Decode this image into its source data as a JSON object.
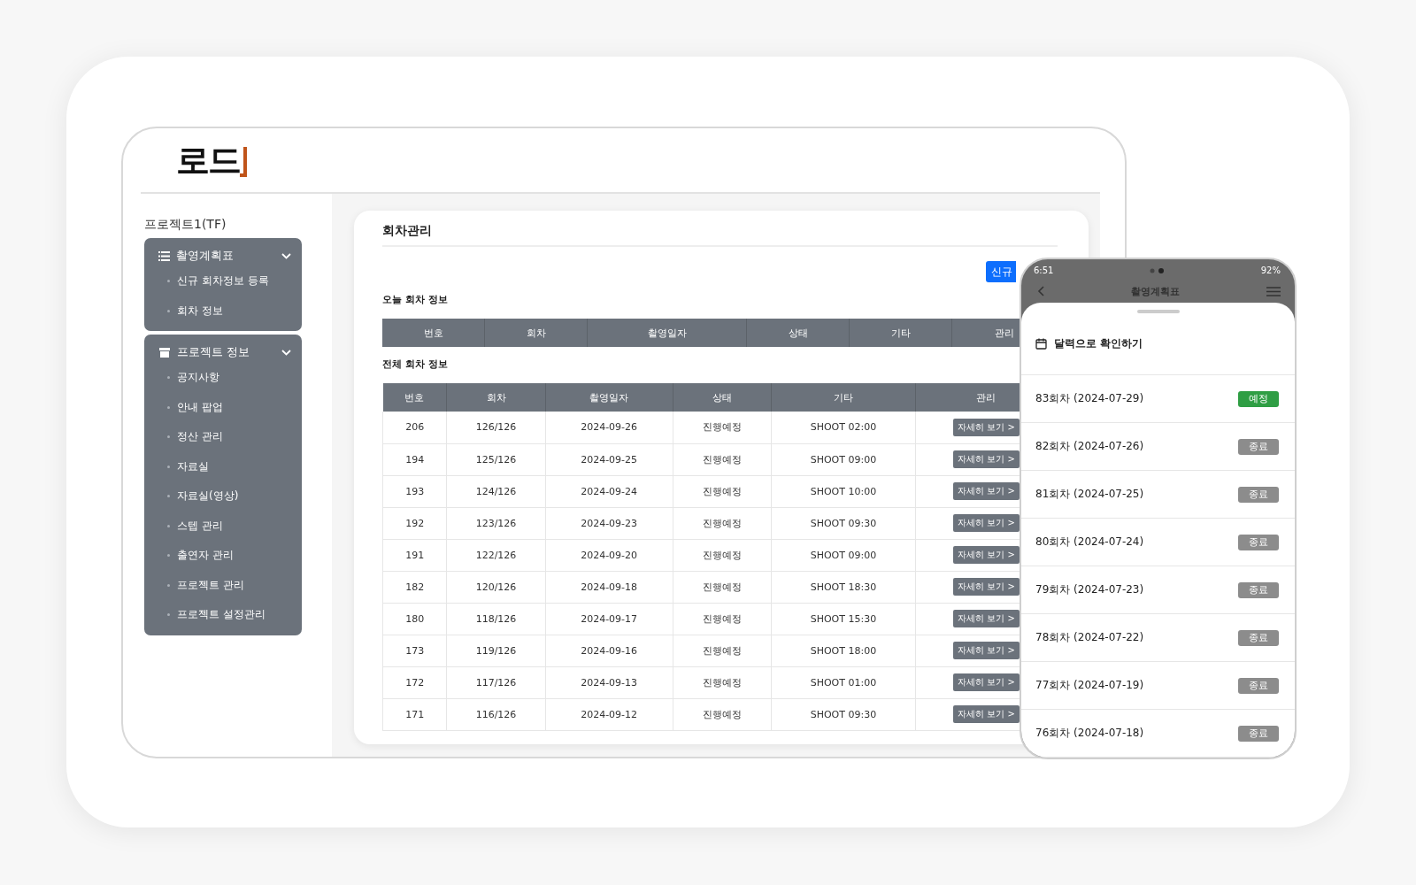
{
  "logo": {
    "text": "로드"
  },
  "sidebar": {
    "project": "프로젝트1(TF)",
    "groups": [
      {
        "title": "촬영계획표",
        "kind": "list",
        "expanded": true,
        "items": [
          "신규 회차정보 등록",
          "회차 정보"
        ]
      },
      {
        "title": "프로젝트 정보",
        "kind": "box",
        "expanded": true,
        "items": [
          "공지사항",
          "안내 팝업",
          "정산 관리",
          "자료실",
          "자료실(영상)",
          "스텝 관리",
          "출연자 관리",
          "프로젝트 관리",
          "프로젝트 설정관리"
        ]
      }
    ]
  },
  "main": {
    "title": "회차관리",
    "new_button": "신규",
    "today": {
      "heading": "오늘 회차 정보",
      "columns": [
        "번호",
        "회차",
        "촬영일자",
        "상태",
        "기타",
        "관리"
      ]
    },
    "all": {
      "heading": "전체 회차 정보",
      "columns": [
        "번호",
        "회차",
        "촬영일자",
        "상태",
        "기타",
        "관리"
      ],
      "rows": [
        {
          "no": "206",
          "round": "126/126",
          "date": "2024-09-26",
          "status": "진행예정",
          "note": "SHOOT 02:00",
          "action": "자세히 보기 >"
        },
        {
          "no": "194",
          "round": "125/126",
          "date": "2024-09-25",
          "status": "진행예정",
          "note": "SHOOT 09:00",
          "action": "자세히 보기 >"
        },
        {
          "no": "193",
          "round": "124/126",
          "date": "2024-09-24",
          "status": "진행예정",
          "note": "SHOOT 10:00",
          "action": "자세히 보기 >"
        },
        {
          "no": "192",
          "round": "123/126",
          "date": "2024-09-23",
          "status": "진행예정",
          "note": "SHOOT 09:30",
          "action": "자세히 보기 >"
        },
        {
          "no": "191",
          "round": "122/126",
          "date": "2024-09-20",
          "status": "진행예정",
          "note": "SHOOT 09:00",
          "action": "자세히 보기 >"
        },
        {
          "no": "182",
          "round": "120/126",
          "date": "2024-09-18",
          "status": "진행예정",
          "note": "SHOOT 18:30",
          "action": "자세히 보기 >"
        },
        {
          "no": "180",
          "round": "118/126",
          "date": "2024-09-17",
          "status": "진행예정",
          "note": "SHOOT 15:30",
          "action": "자세히 보기 >"
        },
        {
          "no": "173",
          "round": "119/126",
          "date": "2024-09-16",
          "status": "진행예정",
          "note": "SHOOT 18:00",
          "action": "자세히 보기 >"
        },
        {
          "no": "172",
          "round": "117/126",
          "date": "2024-09-13",
          "status": "진행예정",
          "note": "SHOOT 01:00",
          "action": "자세히 보기 >"
        },
        {
          "no": "171",
          "round": "116/126",
          "date": "2024-09-12",
          "status": "진행예정",
          "note": "SHOOT 09:30",
          "action": "자세히 보기 >"
        }
      ]
    }
  },
  "phone": {
    "time": "6:51",
    "battery": "92%",
    "title": "촬영계획표",
    "calendar_link": "달력으로 확인하기",
    "items": [
      {
        "label": "83회차 (2024-07-29)",
        "status": "예정",
        "kind": "upcoming"
      },
      {
        "label": "82회차 (2024-07-26)",
        "status": "종료",
        "kind": "done"
      },
      {
        "label": "81회차 (2024-07-25)",
        "status": "종료",
        "kind": "done"
      },
      {
        "label": "80회차 (2024-07-24)",
        "status": "종료",
        "kind": "done"
      },
      {
        "label": "79회차 (2024-07-23)",
        "status": "종료",
        "kind": "done"
      },
      {
        "label": "78회차 (2024-07-22)",
        "status": "종료",
        "kind": "done"
      },
      {
        "label": "77회차 (2024-07-19)",
        "status": "종료",
        "kind": "done"
      },
      {
        "label": "76회차 (2024-07-18)",
        "status": "종료",
        "kind": "done"
      }
    ]
  }
}
